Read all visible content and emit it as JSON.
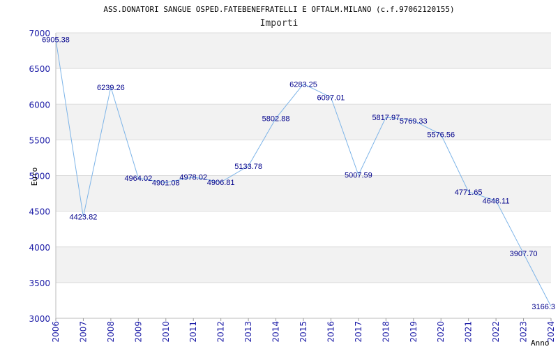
{
  "chart_data": {
    "type": "line",
    "title": "ASS.DONATORI SANGUE OSPED.FATEBENEFRATELLI E OFTALM.MILANO (c.f.97062120155)",
    "subtitle": "Importi",
    "xlabel": "Anno",
    "ylabel": "Euro",
    "ylim": [
      3000,
      7000
    ],
    "yticks": [
      3000,
      3500,
      4000,
      4500,
      5000,
      5500,
      6000,
      6500,
      7000
    ],
    "ytick_labels": [
      "3000",
      "3500",
      "4000",
      "4500",
      "5000",
      "5500",
      "6000",
      "6500",
      "7000"
    ],
    "x": [
      "2006",
      "2007",
      "2008",
      "2009",
      "2010",
      "2011",
      "2012",
      "2013",
      "2014",
      "2015",
      "2016",
      "2017",
      "2018",
      "2019",
      "2020",
      "2021",
      "2022",
      "2023",
      "2024"
    ],
    "values": [
      6905.38,
      4423.82,
      6239.26,
      4964.02,
      4901.08,
      4978.02,
      4906.81,
      5133.78,
      5802.88,
      6283.25,
      6097.01,
      5007.59,
      5817.97,
      5769.33,
      5576.56,
      4771.65,
      4648.11,
      3907.7,
      3166.3
    ],
    "value_labels": [
      "6905.38",
      "4423.82",
      "6239.26",
      "4964.02",
      "4901.08",
      "4978.02",
      "4906.81",
      "5133.78",
      "5802.88",
      "6283.25",
      "6097.01",
      "5007.59",
      "5817.97",
      "5769.33",
      "5576.56",
      "4771.65",
      "4648.11",
      "3907.70",
      "3166.3"
    ],
    "grid": true,
    "legend": "none",
    "colors": {
      "line": "#7db4e8",
      "band": "#f2f2f2",
      "grid": "#dcdcdc",
      "tick_text": "#1a1aa6",
      "label_text": "#00008b"
    }
  }
}
